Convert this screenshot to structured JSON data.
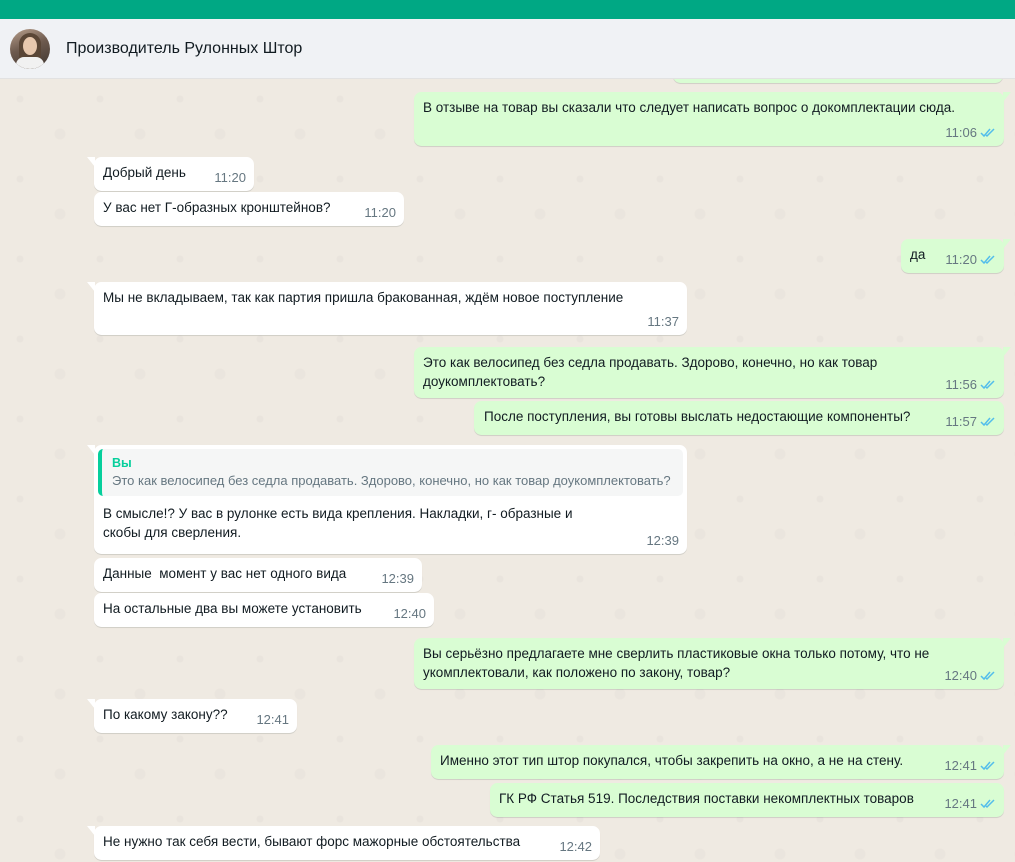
{
  "header": {
    "contact_name": "Производитель Рулонных Штор"
  },
  "colors": {
    "accent": "#00a884",
    "incoming_bubble": "#ffffff",
    "outgoing_bubble": "#d9fdd3",
    "read_ticks": "#53bdeb"
  },
  "messages": [
    {
      "dir": "out",
      "text": "В отзыве на товар вы сказали что следует написать вопрос о докомплектации сюда.",
      "time": "11:06",
      "read": true
    },
    {
      "dir": "in",
      "text": "Добрый день",
      "time": "11:20"
    },
    {
      "dir": "in",
      "text": "У вас нет Г-образных кронштейнов?",
      "time": "11:20"
    },
    {
      "dir": "out",
      "text": "да",
      "time": "11:20",
      "read": true
    },
    {
      "dir": "in",
      "text": "Мы не вкладываем, так как партия пришла бракованная, ждём новое поступление",
      "time": "11:37"
    },
    {
      "dir": "out",
      "text": "Это как велосипед без седла продавать. Здорово, конечно, но как товар доукомплектовать?",
      "time": "11:56",
      "read": true
    },
    {
      "dir": "out",
      "text": "После поступления, вы готовы выслать недостающие компоненты?",
      "time": "11:57",
      "read": true
    },
    {
      "dir": "in",
      "quote_author": "Вы",
      "quote_text": "Это как велосипед без седла продавать. Здорово, конечно, но как товар доукомплектовать?",
      "text": "В смысле!? У вас в рулонке есть вида крепления. Накладки, г- образные и скобы для сверления.",
      "time": "12:39"
    },
    {
      "dir": "in",
      "text": "Данные  момент у вас нет одного вида",
      "time": "12:39"
    },
    {
      "dir": "in",
      "text": "На остальные два вы можете установить",
      "time": "12:40"
    },
    {
      "dir": "out",
      "text": "Вы серьёзно предлагаете мне сверлить пластиковые окна только потому, что не укомплектовали, как положено по закону, товар?",
      "time": "12:40",
      "read": true
    },
    {
      "dir": "in",
      "text": "По какому закону??",
      "time": "12:41"
    },
    {
      "dir": "out",
      "text": "Именно этот тип штор покупался, чтобы закрепить на окно, а не на стену.",
      "time": "12:41",
      "read": true
    },
    {
      "dir": "out",
      "text": "ГК РФ Статья 519. Последствия поставки некомплектных товаров",
      "time": "12:41",
      "read": true
    },
    {
      "dir": "in",
      "text": "Не нужно так себя вести, бывают форс мажорные обстоятельства",
      "time": "12:42"
    }
  ]
}
